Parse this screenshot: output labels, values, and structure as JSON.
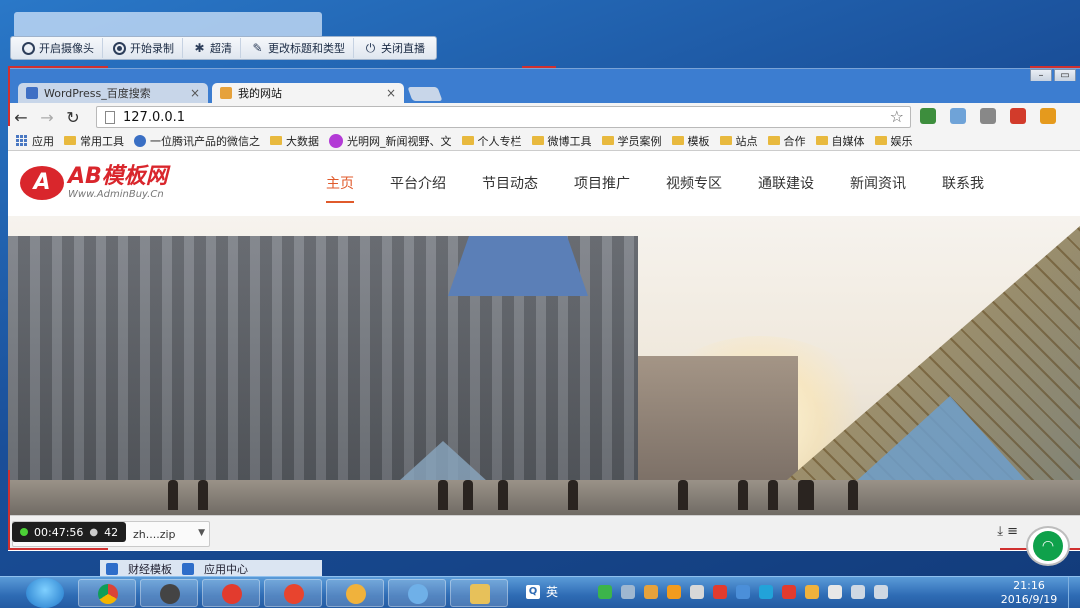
{
  "recorder": {
    "buttons": [
      {
        "label": "开启摄像头",
        "icon": "camera-icon"
      },
      {
        "label": "开始录制",
        "icon": "record-icon"
      },
      {
        "label": "超清",
        "icon": "quality-icon"
      },
      {
        "label": "更改标题和类型",
        "icon": "edit-icon"
      },
      {
        "label": "关闭直播",
        "icon": "power-icon"
      }
    ],
    "timer": "00:47:56",
    "viewers": "42"
  },
  "browser": {
    "tabs": [
      {
        "title": "WordPress_百度搜索",
        "active": false
      },
      {
        "title": "我的网站",
        "active": true
      }
    ],
    "url": "127.0.0.1",
    "bookmarks": [
      {
        "label": "应用",
        "type": "apps"
      },
      {
        "label": "常用工具",
        "type": "folder"
      },
      {
        "label": "一位腾讯产品的微信之",
        "type": "globe"
      },
      {
        "label": "大数据",
        "type": "folder"
      },
      {
        "label": "光明网_新闻视野、文",
        "type": "gm"
      },
      {
        "label": "个人专栏",
        "type": "folder"
      },
      {
        "label": "微博工具",
        "type": "folder"
      },
      {
        "label": "学员案例",
        "type": "folder"
      },
      {
        "label": "模板",
        "type": "folder"
      },
      {
        "label": "站点",
        "type": "folder"
      },
      {
        "label": "合作",
        "type": "folder"
      },
      {
        "label": "自媒体",
        "type": "folder"
      },
      {
        "label": "娱乐",
        "type": "folder"
      }
    ],
    "download": {
      "filename": "zh....zip"
    }
  },
  "site": {
    "logo_main": "AB模板网",
    "logo_sub": "Www.AdminBuy.Cn",
    "logo_mark": "A",
    "nav": [
      {
        "label": "主页",
        "active": true
      },
      {
        "label": "平台介绍",
        "active": false
      },
      {
        "label": "节目动态",
        "active": false
      },
      {
        "label": "项目推广",
        "active": false
      },
      {
        "label": "视频专区",
        "active": false
      },
      {
        "label": "通联建设",
        "active": false
      },
      {
        "label": "新闻资讯",
        "active": false
      },
      {
        "label": "联系我",
        "active": false
      }
    ],
    "accent_color": "#e05a2b"
  },
  "app_strip": {
    "items": [
      {
        "label": "财经模板"
      },
      {
        "label": "应用中心"
      }
    ]
  },
  "taskbar": {
    "ime_label": "英",
    "time": "21:16",
    "date": "2016/9/19"
  }
}
